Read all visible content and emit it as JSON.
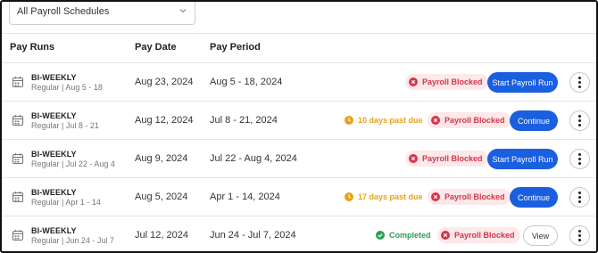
{
  "filter": {
    "selected": "All Payroll Schedules",
    "icon": "chevron-down-icon"
  },
  "columns": {
    "pay_runs": "Pay Runs",
    "pay_date": "Pay Date",
    "pay_period": "Pay Period"
  },
  "rows": [
    {
      "title": "BI-WEEKLY",
      "subtitle": "Regular | Aug 5 - 18",
      "pay_date": "Aug 23, 2024",
      "pay_period": "Aug 5 - 18, 2024",
      "late": "",
      "completed": "",
      "blocked": "Payroll Blocked",
      "action": "Start Payroll Run"
    },
    {
      "title": "BI-WEEKLY",
      "subtitle": "Regular | Jul 8 - 21",
      "pay_date": "Aug 12, 2024",
      "pay_period": "Jul 8 - 21, 2024",
      "late": "10 days past due",
      "completed": "",
      "blocked": "Payroll Blocked",
      "action": "Continue"
    },
    {
      "title": "BI-WEEKLY",
      "subtitle": "Regular | Jul 22 - Aug 4",
      "pay_date": "Aug 9, 2024",
      "pay_period": "Jul 22 - Aug 4, 2024",
      "late": "",
      "completed": "",
      "blocked": "Payroll Blocked",
      "action": "Start Payroll Run"
    },
    {
      "title": "BI-WEEKLY",
      "subtitle": "Regular | Apr 1 - 14",
      "pay_date": "Aug 5, 2024",
      "pay_period": "Apr 1 - 14, 2024",
      "late": "17 days past due",
      "completed": "",
      "blocked": "Payroll Blocked",
      "action": "Continue"
    },
    {
      "title": "BI-WEEKLY",
      "subtitle": "Regular | Jun 24 - Jul 7",
      "pay_date": "Jul 12, 2024",
      "pay_period": "Jun 24 - Jul 7, 2024",
      "late": "",
      "completed": "Completed",
      "blocked": "Payroll Blocked",
      "action": "View"
    }
  ],
  "colors": {
    "primary": "#1a5fe0",
    "blocked_text": "#d4364a",
    "blocked_bg": "#fde8ea",
    "warning": "#e8a219",
    "success": "#2e9f52"
  },
  "icons": {
    "row_icon": "calendar-icon",
    "blocked": "x-circle-icon",
    "late": "clock-icon",
    "completed": "check-circle-icon",
    "menu": "more-vertical-icon"
  }
}
